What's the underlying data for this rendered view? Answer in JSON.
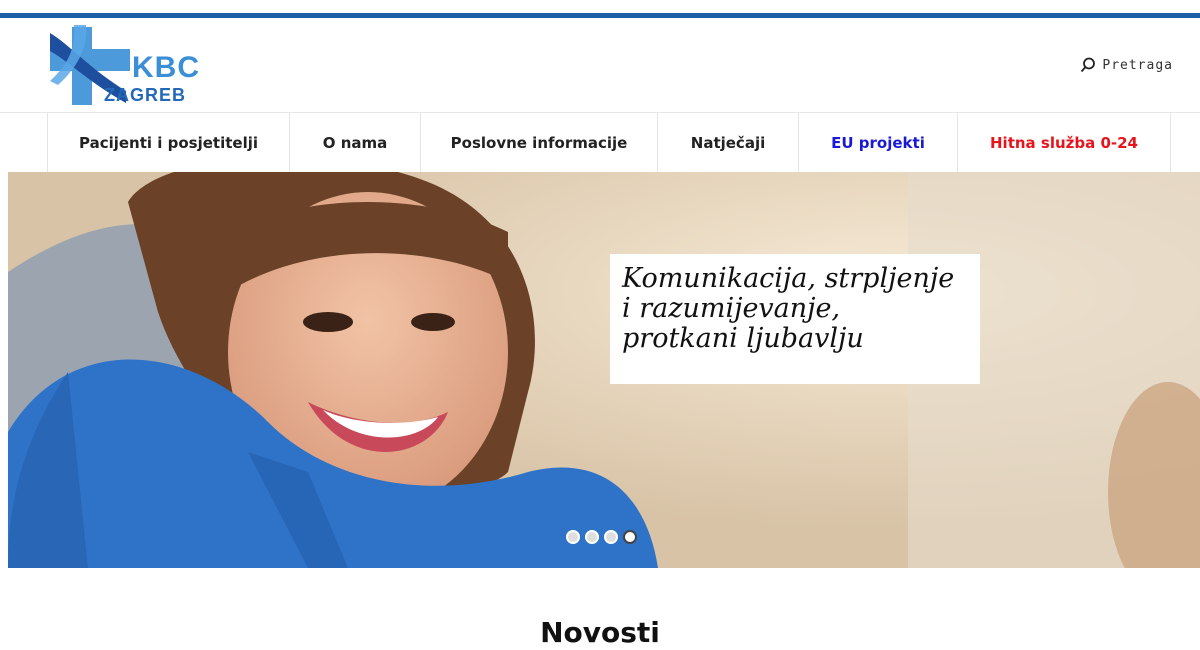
{
  "header": {
    "logo": {
      "line1": "KBC",
      "line2": "ZAGREB"
    },
    "search_label": "Pretraga"
  },
  "nav": [
    {
      "label": "Pacijenti i posjetitelji",
      "color": "#222222"
    },
    {
      "label": "O nama",
      "color": "#222222"
    },
    {
      "label": "Poslovne informacije",
      "color": "#222222"
    },
    {
      "label": "Natječaji",
      "color": "#222222"
    },
    {
      "label": "EU projekti",
      "color": "#1a1ad6"
    },
    {
      "label": "Hitna služba 0-24",
      "color": "#e8141c"
    }
  ],
  "hero": {
    "caption_lines": [
      "Komunikacija, strpljenje",
      "i razumijevanje,",
      "protkani ljubavlju"
    ],
    "slides": 4,
    "active_slide": 4
  },
  "section": {
    "title": "Novosti"
  },
  "colors": {
    "brand": "#1d5fa6",
    "accent": "#3a8fd6"
  }
}
